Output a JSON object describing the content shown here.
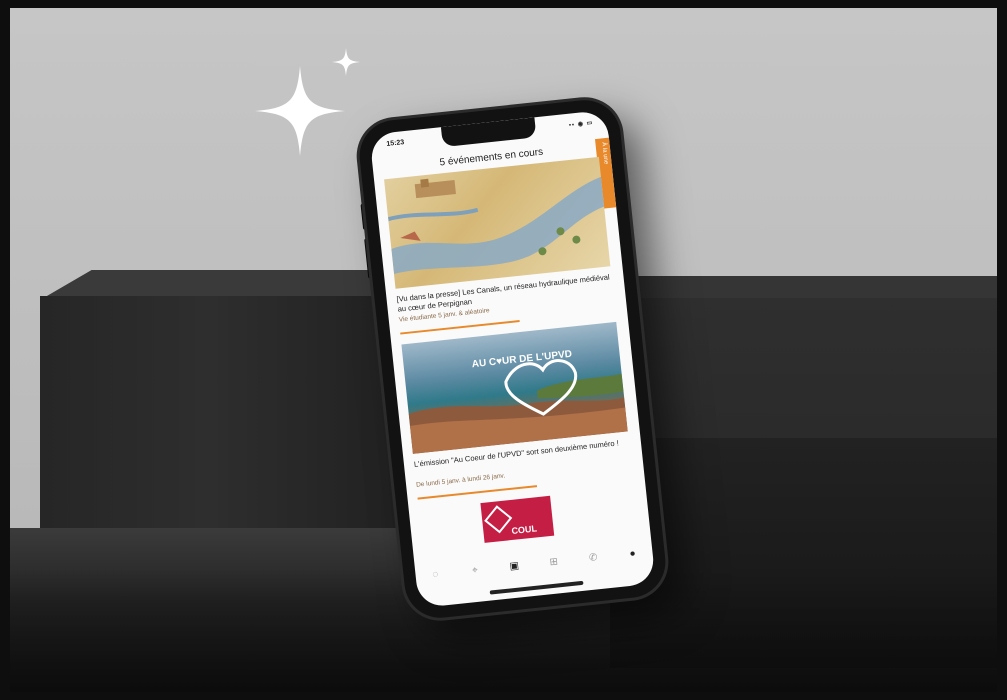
{
  "phone": {
    "status_time": "15:23",
    "status_icons": "▪▪ ◉ ▭",
    "header_title": "5 événements en cours",
    "orange_tab_label": "À la une",
    "cards": [
      {
        "title": "[Vu dans la presse] Les Canals, un réseau hydraulique médiéval au cœur de Perpignan",
        "subtitle": "Vie étudiante 5 janv. & aléatoire"
      },
      {
        "image_text": "AU C♥UR DE L'UPVD",
        "title": "L'émission \"Au Coeur de l'UPVD\" sort son deuxième numéro !",
        "subtitle": "De lundi 5 janv. à lundi 26 janv."
      },
      {
        "image_text": "COUL"
      }
    ],
    "tabbar_icons": [
      "home-icon",
      "location-icon",
      "calendar-icon",
      "grid-icon",
      "phone-icon",
      "settings-icon"
    ],
    "tabbar_glyphs": [
      "◌",
      "⌖",
      "▣",
      "⊞",
      "✆",
      "●"
    ]
  },
  "colors": {
    "accent": "#e8892b",
    "brand_red": "#c41e45",
    "background": "#c2c2c2"
  }
}
